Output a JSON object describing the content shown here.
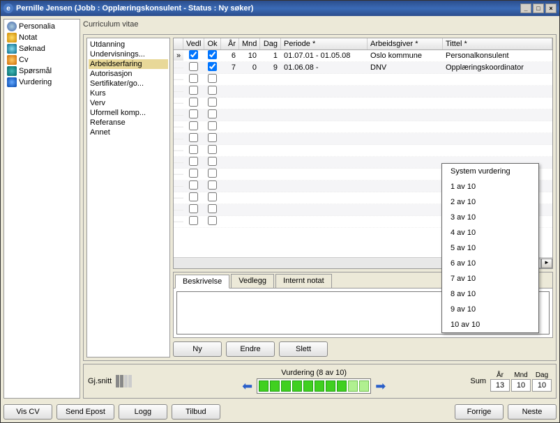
{
  "window": {
    "title": "Pernille Jensen (Jobb : Opplæringskonsulent - Status : Ny søker)"
  },
  "leftnav": {
    "items": [
      {
        "label": "Personalia"
      },
      {
        "label": "Notat"
      },
      {
        "label": "Søknad"
      },
      {
        "label": "Cv"
      },
      {
        "label": "Spørsmål"
      },
      {
        "label": "Vurdering"
      }
    ]
  },
  "section_title": "Curriculum vitae",
  "cvnav": {
    "items": [
      {
        "label": "Utdanning"
      },
      {
        "label": "Undervisnings..."
      },
      {
        "label": "Arbeidserfaring"
      },
      {
        "label": "Autorisasjon"
      },
      {
        "label": "Sertifikater/go..."
      },
      {
        "label": "Kurs"
      },
      {
        "label": "Verv"
      },
      {
        "label": "Uformell komp..."
      },
      {
        "label": "Referanse"
      },
      {
        "label": "Annet"
      }
    ]
  },
  "grid": {
    "headers": {
      "vedl": "Vedl",
      "ok": "Ok",
      "ar": "År",
      "mnd": "Mnd",
      "dag": "Dag",
      "periode": "Periode *",
      "arbeidsgiver": "Arbeidsgiver *",
      "tittel": "Tittel *"
    },
    "rows": [
      {
        "vedl": true,
        "ok": true,
        "ar": "6",
        "mnd": "10",
        "dag": "1",
        "periode": "01.07.01 - 01.05.08",
        "arbeidsgiver": "Oslo kommune",
        "tittel": "Personalkonsulent"
      },
      {
        "vedl": false,
        "ok": true,
        "ar": "7",
        "mnd": "0",
        "dag": "9",
        "periode": "01.06.08 -",
        "arbeidsgiver": "DNV",
        "tittel": "Opplæringskoordinator"
      }
    ]
  },
  "tabs": {
    "beskrivelse": "Beskrivelse",
    "vedlegg": "Vedlegg",
    "internt_notat": "Internt notat"
  },
  "buttons": {
    "ny": "Ny",
    "endre": "Endre",
    "slett": "Slett",
    "vis_cv": "Vis CV",
    "send_epost": "Send Epost",
    "logg": "Logg",
    "tilbud": "Tilbud",
    "forrige": "Forrige",
    "neste": "Neste"
  },
  "rating": {
    "gjsnitt": "Gj.snitt",
    "label": "Vurdering (8 av 10)",
    "sum_label": "Sum",
    "ar": "År",
    "ar_val": "13",
    "mnd": "Mnd",
    "mnd_val": "10",
    "dag": "Dag",
    "dag_val": "10"
  },
  "dropdown": {
    "header": "System vurdering",
    "items": [
      "1 av 10",
      "2 av 10",
      "3 av 10",
      "4 av 10",
      "5 av 10",
      "6 av 10",
      "7 av 10",
      "8 av 10",
      "9 av 10",
      "10 av 10"
    ]
  }
}
